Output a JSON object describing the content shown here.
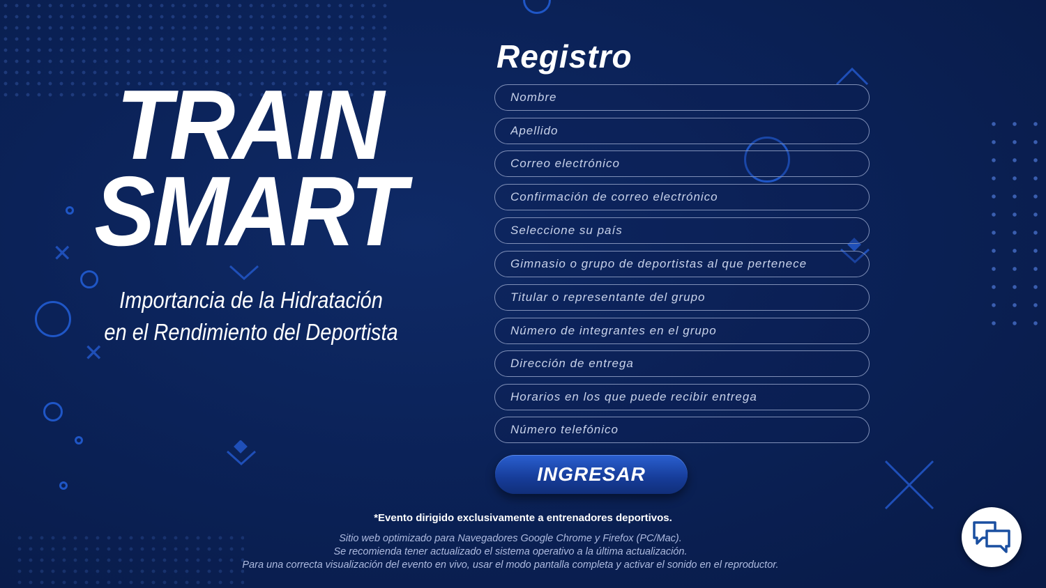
{
  "hero": {
    "title_line1": "TRAIN",
    "title_line2": "SMART",
    "subtitle_line1": "Importancia de la Hidratación",
    "subtitle_line2": "en el Rendimiento del Deportista"
  },
  "form": {
    "title": "Registro",
    "fields": [
      {
        "placeholder": "Nombre",
        "value": ""
      },
      {
        "placeholder": "Apellido",
        "value": ""
      },
      {
        "placeholder": "Correo electrónico",
        "value": ""
      },
      {
        "placeholder": "Confirmación de correo electrónico",
        "value": ""
      },
      {
        "placeholder": "Seleccione su país",
        "value": ""
      },
      {
        "placeholder": "Gimnasio o grupo de deportistas al que pertenece",
        "value": ""
      },
      {
        "placeholder": "Titular o representante del grupo",
        "value": ""
      },
      {
        "placeholder": "Número de integrantes en el grupo",
        "value": ""
      },
      {
        "placeholder": "Dirección de entrega",
        "value": ""
      },
      {
        "placeholder": "Horarios en los que puede recibir entrega",
        "value": ""
      },
      {
        "placeholder": "Número telefónico",
        "value": ""
      }
    ],
    "submit_label": "INGRESAR"
  },
  "footer": {
    "notice": "*Evento dirigido exclusivamente a entrenadores deportivos.",
    "info_line1": "Sitio web optimizado para Navegadores Google Chrome y Firefox (PC/Mac).",
    "info_line2": "Se recomienda tener actualizado el sistema operativo a la última actualización.",
    "info_line3": "Para una correcta visualización del evento en vivo, usar el modo pantalla completa y activar el sonido en el reproductor."
  },
  "chat": {
    "icon": "chat-bubbles-icon"
  },
  "colors": {
    "background": "#0b2258",
    "accent_blue": "#1f56c6",
    "button": "#163c98",
    "field_border": "#8090b8"
  }
}
